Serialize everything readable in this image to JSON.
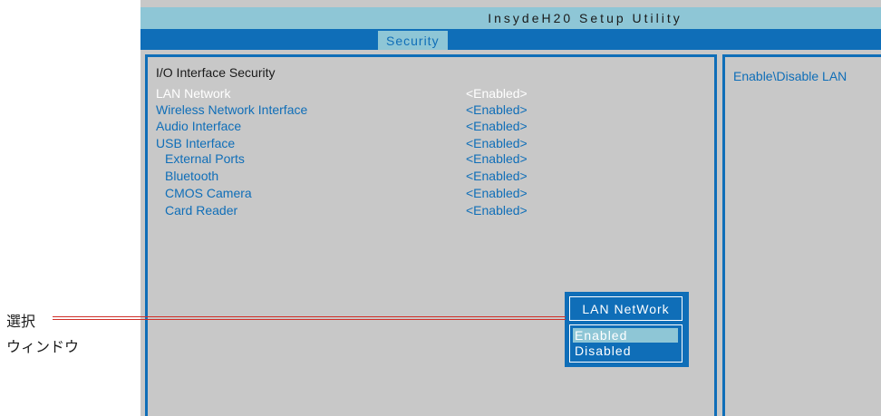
{
  "app": {
    "title": "InsydeH20 Setup Utility",
    "active_tab": "Security"
  },
  "main": {
    "section_title": "I/O Interface Security",
    "items": [
      {
        "label": "LAN Network",
        "value": "<Enabled>",
        "selected": true,
        "indent": false
      },
      {
        "label": "Wireless Network Interface",
        "value": "<Enabled>",
        "selected": false,
        "indent": false
      },
      {
        "label": "Audio Interface",
        "value": "<Enabled>",
        "selected": false,
        "indent": false
      },
      {
        "label": "USB Interface",
        "value": "<Enabled>",
        "selected": false,
        "indent": false
      },
      {
        "label": "External Ports",
        "value": "<Enabled>",
        "selected": false,
        "indent": true
      },
      {
        "label": "Bluetooth",
        "value": "<Enabled>",
        "selected": false,
        "indent": true
      },
      {
        "label": "CMOS Camera",
        "value": "<Enabled>",
        "selected": false,
        "indent": true
      },
      {
        "label": "Card Reader",
        "value": "<Enabled>",
        "selected": false,
        "indent": true
      }
    ]
  },
  "help": {
    "text": "Enable\\Disable  LAN"
  },
  "popup": {
    "title": "LAN NetWork",
    "options": [
      "Enabled",
      "Disabled"
    ],
    "highlighted": "Enabled"
  },
  "callout": {
    "line1": "選択",
    "line2": "ウィンドウ"
  },
  "colors": {
    "accent_blue": "#0f6eb8",
    "light_cyan": "#8ec6d6",
    "panel_gray": "#c8c8c8",
    "callout_red": "#d0302a"
  }
}
